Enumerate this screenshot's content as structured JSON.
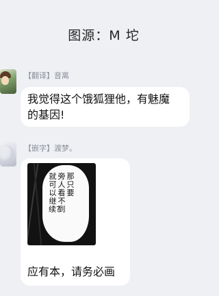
{
  "header": {
    "title": "图源：M 坨"
  },
  "messages": [
    {
      "sender": "【翻译】音离",
      "avatar_icon": "avatar-illustration-icon",
      "text_line1": "我觉得这个饿狐狸他，有魅魔",
      "text_line2": "的基因!"
    },
    {
      "sender": "【嵌字】渡梦。",
      "avatar_icon": "avatar-illustration-icon",
      "image": {
        "speech_col1": "那只要",
        "speech_col2": "旁人看不到",
        "speech_col3": "就可以继续?"
      },
      "caption": "应有本，请务必画"
    }
  ]
}
